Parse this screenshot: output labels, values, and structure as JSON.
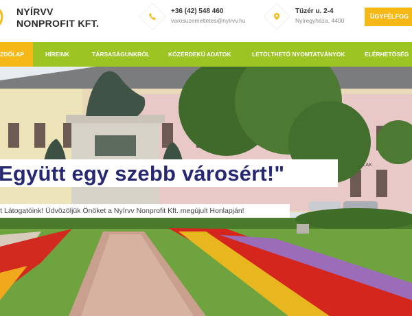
{
  "brand": {
    "line1": "NYÍRVV",
    "line2": "NONPROFIT KFT."
  },
  "contact": {
    "phone": "+36 (42) 548 460",
    "email": "varosuzemeltetes@nyirvv.hu",
    "street": "Tüzér u. 2-4",
    "city": "Nyíregyháza, 4400"
  },
  "cta_label": "ÜGYFÉLFOG",
  "nav": {
    "items": [
      {
        "label": "ZDŐLAP",
        "active": true
      },
      {
        "label": "HÍREINK"
      },
      {
        "label": "TÁRSASÁGUNKRÓL"
      },
      {
        "label": "KÖZÉRDEKŰ ADATOK"
      },
      {
        "label": "LETÖLTHETŐ NYOMTATVÁNYOK"
      },
      {
        "label": "ELÉRHETŐSÉG"
      }
    ]
  },
  "hero": {
    "headline": "Együtt egy szebb városért!\"",
    "subline": "elt Látogatóink! Üdvözöljük Önöket a Nyírvv Nonprofit Kft. megújult Honlapján!",
    "sign_text": "NYABLAK"
  },
  "colors": {
    "green": "#9cc423",
    "yellow": "#f5b816",
    "navy": "#262872"
  },
  "icons": {
    "phone": "phone-icon",
    "location": "location-pin-icon",
    "logo": "logo-leaf-icon"
  }
}
